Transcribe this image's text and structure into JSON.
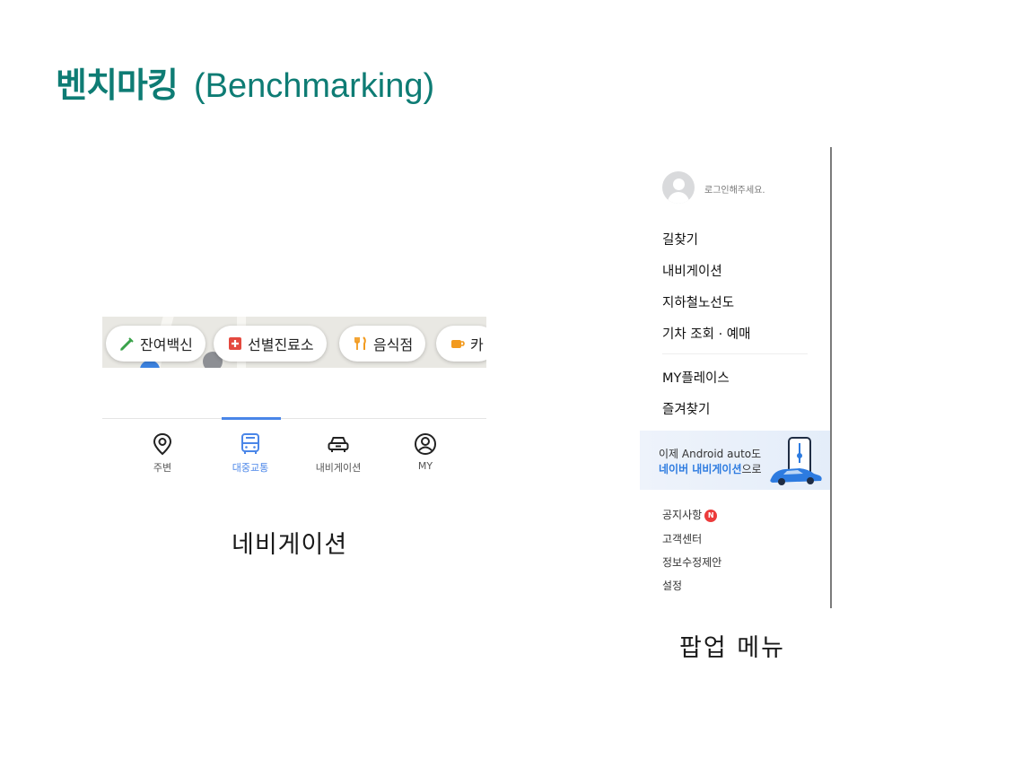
{
  "slide": {
    "title_ko": "벤치마킹",
    "title_en": "(Benchmarking)",
    "caption_left": "네비게이션",
    "caption_right": "팝업 메뉴"
  },
  "colors": {
    "title": "#0e7c74",
    "accent_blue": "#4a86e8",
    "badge_red": "#ec3b3b"
  },
  "map_chips": [
    {
      "label": "잔여백신",
      "icon": "syringe-icon",
      "icon_color": "#3aa24a"
    },
    {
      "label": "선별진료소",
      "icon": "medical-cross-icon",
      "icon_color": "#e4493f"
    },
    {
      "label": "음식점",
      "icon": "fork-knife-icon",
      "icon_color": "#f29a1e"
    },
    {
      "label": "카",
      "icon": "coffee-cup-icon",
      "icon_color": "#f29a1e"
    }
  ],
  "bottom_tabs": [
    {
      "label": "주변",
      "icon": "location-pin-icon",
      "active": false
    },
    {
      "label": "대중교통",
      "icon": "bus-icon",
      "active": true
    },
    {
      "label": "내비게이션",
      "icon": "car-icon",
      "active": false
    },
    {
      "label": "MY",
      "icon": "user-circle-icon",
      "active": false
    }
  ],
  "popup_menu": {
    "login_prompt": "로그인해주세요.",
    "items": [
      "길찾기",
      "내비게이션",
      "지하철노선도",
      "기차 조회 · 예매"
    ],
    "items2": [
      "MY플레이스",
      "즐겨찾기"
    ],
    "banner": {
      "line1": "이제 Android auto도",
      "line2_highlight": "네이버 내비게이션",
      "line2_suffix": "으로"
    },
    "sub_items": [
      {
        "label": "공지사항",
        "badge": "N"
      },
      {
        "label": "고객센터"
      },
      {
        "label": "정보수정제안"
      },
      {
        "label": "설정"
      }
    ]
  }
}
